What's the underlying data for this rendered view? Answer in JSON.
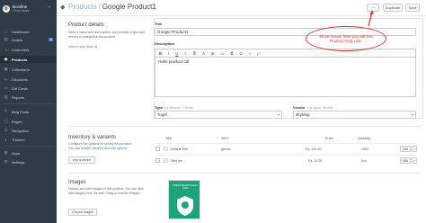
{
  "sidebar": {
    "store_name": "bicorline",
    "store_sub": "Vinay yadav",
    "logo_letter": "b",
    "items": [
      {
        "label": "Dashboard",
        "icon": "home-icon"
      },
      {
        "label": "Orders",
        "icon": "orders-icon",
        "badge": "3"
      },
      {
        "label": "Customers",
        "icon": "customers-icon"
      },
      {
        "label": "Products",
        "icon": "products-icon",
        "active": true
      },
      {
        "label": "Collections",
        "icon": "collections-icon"
      },
      {
        "label": "Discounts",
        "icon": "discounts-icon"
      },
      {
        "label": "Gift Cards",
        "icon": "gift-card-icon"
      },
      {
        "label": "Reports",
        "icon": "reports-icon"
      },
      {
        "label": "Blog Posts",
        "icon": "blog-icon"
      },
      {
        "label": "Pages",
        "icon": "pages-icon"
      },
      {
        "label": "Navigation",
        "icon": "navigation-icon"
      },
      {
        "label": "Themes",
        "icon": "themes-icon"
      },
      {
        "label": "Apps",
        "icon": "apps-icon"
      },
      {
        "label": "Settings",
        "icon": "settings-icon"
      }
    ]
  },
  "header": {
    "breadcrumb_parent": "Products",
    "breadcrumb_separator": "/",
    "title": "Google Product1",
    "more_label": "···",
    "duplicate_label": "Duplicate",
    "save_label": "Save"
  },
  "product_details": {
    "title": "Product details",
    "description": "Write a name and description, and provide a type and vendor to categorize this product.",
    "view_link": "View in your store"
  },
  "form": {
    "title_label": "Title",
    "title_value": "Google Product1",
    "description_label": "Description",
    "toolbar": [
      "B",
      "I",
      "U",
      "≡",
      "≣",
      "A",
      "⊞",
      "▭",
      "⧉",
      "Ω",
      "‹›",
      "⤢"
    ],
    "description_value": "Hello product cdf",
    "type_label": "Type",
    "type_hint": "e.g. Bicycles, T-Shirts",
    "type_value": "Togel",
    "vendor_label": "Vendor",
    "vendor_hint": "e.g. Apple, Shopify",
    "vendor_value": "skyblog"
  },
  "annotation": {
    "text": "Move mouse here you will find Product FAQ Link.",
    "color": "#d93030"
  },
  "inventory": {
    "title": "Inventory & variants",
    "description": "Configure the options for selling this product.",
    "desc2_prefix": "You can",
    "reorder_link": "reorder variants",
    "desc2_mid": "and",
    "edit_link": "edit options",
    "add_variant": "Add a variant",
    "columns": [
      "Title",
      "SKU",
      "Price",
      "Quantity"
    ],
    "rows": [
      {
        "title": "Default Title",
        "sku": "gtsmlc",
        "price": "Rs. 100.00",
        "quantity": "1000",
        "edit": "Edit"
      },
      {
        "title": "New ink",
        "sku": "",
        "price": "Rs. 10.00",
        "quantity": "5ch",
        "edit": "Edit"
      }
    ]
  },
  "images": {
    "title": "Images",
    "description": "Upload and edit images of this product. You can also add images from the web. Drag to reorder images.",
    "manage_button": "Choose images",
    "thumb_caption": "PRESTASHOP Product Label",
    "thumb_color": "#1fa17a"
  }
}
